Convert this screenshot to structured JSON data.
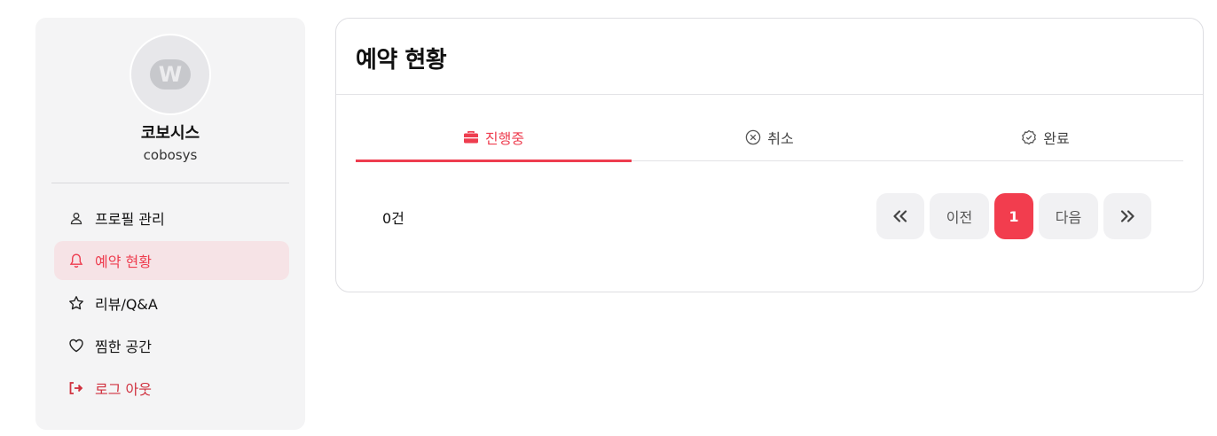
{
  "profile": {
    "avatar_letter": "W",
    "name": "코보시스",
    "username": "cobosys"
  },
  "sidebar": {
    "items": [
      {
        "label": "프로필 관리",
        "icon": "user-icon",
        "active": false
      },
      {
        "label": "예약 현황",
        "icon": "bell-icon",
        "active": true
      },
      {
        "label": "리뷰/Q&A",
        "icon": "star-icon",
        "active": false
      },
      {
        "label": "찜한 공간",
        "icon": "heart-icon",
        "active": false
      },
      {
        "label": "로그 아웃",
        "icon": "logout-icon",
        "active": false
      }
    ]
  },
  "main": {
    "title": "예약 현황",
    "tabs": [
      {
        "label": "진행중",
        "icon": "briefcase-icon",
        "active": true
      },
      {
        "label": "취소",
        "icon": "x-circle-icon",
        "active": false
      },
      {
        "label": "완료",
        "icon": "check-badge-icon",
        "active": false
      }
    ],
    "count_text": "0건",
    "pagination": {
      "first_symbol": "«",
      "prev_label": "이전",
      "current_page": "1",
      "next_label": "다음",
      "last_symbol": "»"
    }
  },
  "colors": {
    "accent": "#ee3d4f",
    "active_bg": "#f6e3e6",
    "sidebar_bg": "#f4f4f5",
    "button_bg": "#f1f1f3"
  }
}
